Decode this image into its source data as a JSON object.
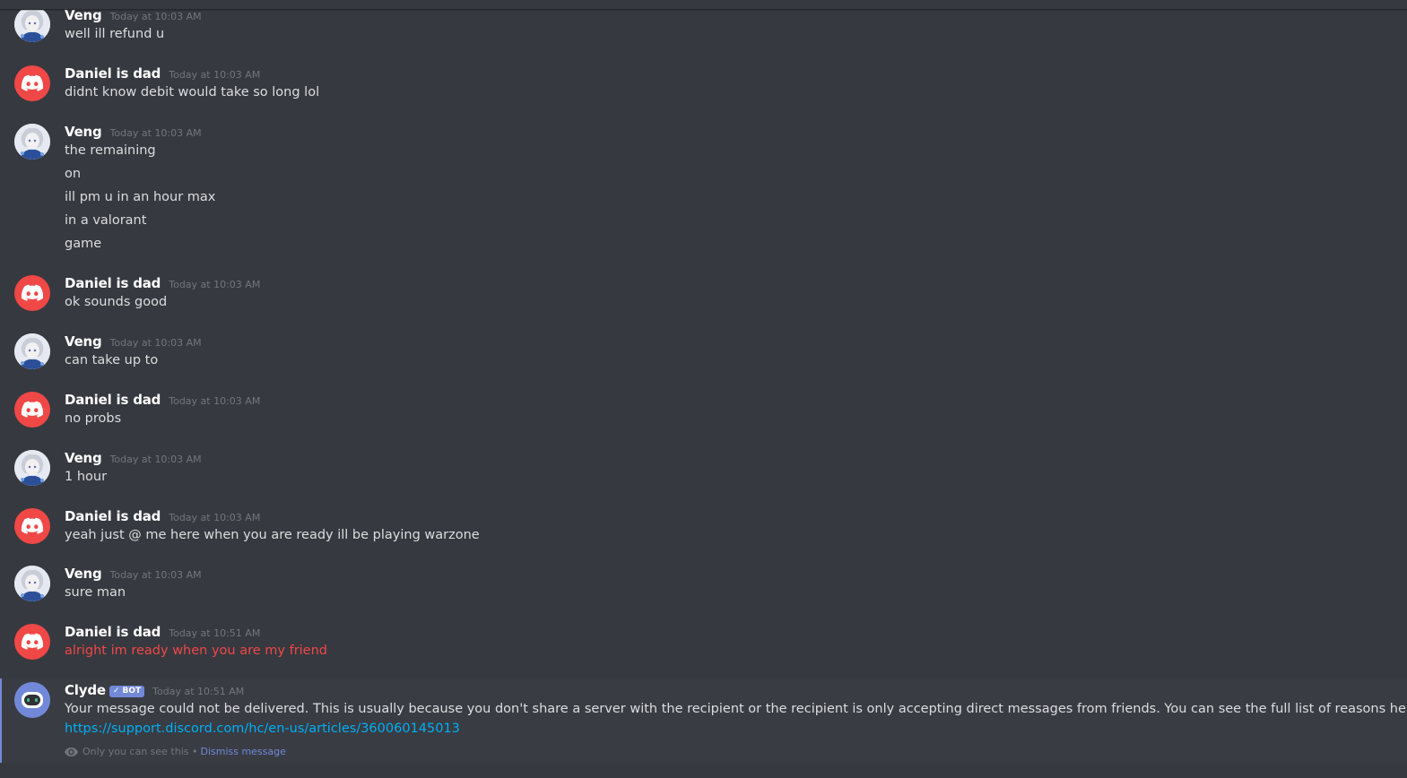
{
  "colors": {
    "background": "#36393f",
    "accent": "#7289da",
    "error": "#f04747",
    "link": "#00b0f4"
  },
  "messages": [
    {
      "author": "Veng",
      "avatar": "veng-avatar",
      "timestamp": "Today at 10:03 AM",
      "lines": [
        "well ill refund u"
      ]
    },
    {
      "author": "Daniel is dad",
      "avatar": "discord-default-avatar",
      "timestamp": "Today at 10:03 AM",
      "lines": [
        "didnt know debit would take so long lol"
      ]
    },
    {
      "author": "Veng",
      "avatar": "veng-avatar",
      "timestamp": "Today at 10:03 AM",
      "lines": [
        "the remaining",
        "on",
        "ill pm u in an hour max",
        "in a valorant",
        "game"
      ]
    },
    {
      "author": "Daniel is dad",
      "avatar": "discord-default-avatar",
      "timestamp": "Today at 10:03 AM",
      "lines": [
        "ok sounds good"
      ]
    },
    {
      "author": "Veng",
      "avatar": "veng-avatar",
      "timestamp": "Today at 10:03 AM",
      "lines": [
        "can take up to"
      ]
    },
    {
      "author": "Daniel is dad",
      "avatar": "discord-default-avatar",
      "timestamp": "Today at 10:03 AM",
      "lines": [
        "no probs"
      ]
    },
    {
      "author": "Veng",
      "avatar": "veng-avatar",
      "timestamp": "Today at 10:03 AM",
      "lines": [
        "1 hour"
      ]
    },
    {
      "author": "Daniel is dad",
      "avatar": "discord-default-avatar",
      "timestamp": "Today at 10:03 AM",
      "lines": [
        "yeah just @ me here when you are ready ill be playing warzone"
      ]
    },
    {
      "author": "Veng",
      "avatar": "veng-avatar",
      "timestamp": "Today at 10:03 AM",
      "lines": [
        "sure man"
      ]
    },
    {
      "author": "Daniel is dad",
      "avatar": "discord-default-avatar",
      "timestamp": "Today at 10:51 AM",
      "lines": [
        "alright im ready when you are my friend"
      ],
      "failed": true
    }
  ],
  "clyde": {
    "author": "Clyde",
    "badge": "✓ BOT",
    "timestamp": "Today at 10:51 AM",
    "text": "Your message could not be delivered. This is usually because you don't share a server with the recipient or the recipient is only accepting direct messages from friends. You can see the full list of reasons here:",
    "link": "https://support.discord.com/hc/en-us/articles/360060145013",
    "ephemeral_note": "Only you can see this •",
    "dismiss_label": "Dismiss message"
  }
}
